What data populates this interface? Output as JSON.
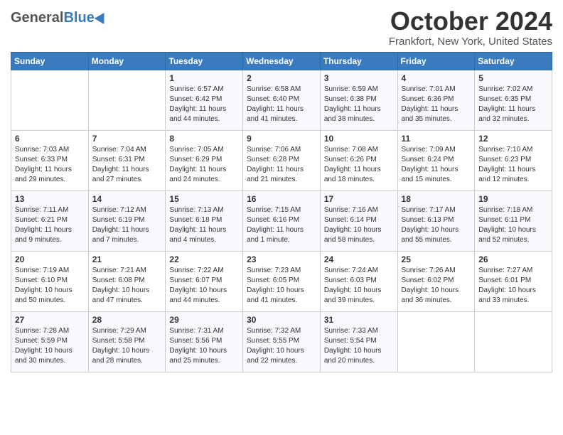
{
  "header": {
    "logo_general": "General",
    "logo_blue": "Blue",
    "month_title": "October 2024",
    "subtitle": "Frankfort, New York, United States"
  },
  "days_of_week": [
    "Sunday",
    "Monday",
    "Tuesday",
    "Wednesday",
    "Thursday",
    "Friday",
    "Saturday"
  ],
  "weeks": [
    [
      null,
      null,
      {
        "day": 1,
        "sunrise": "Sunrise: 6:57 AM",
        "sunset": "Sunset: 6:42 PM",
        "daylight": "Daylight: 11 hours and 44 minutes."
      },
      {
        "day": 2,
        "sunrise": "Sunrise: 6:58 AM",
        "sunset": "Sunset: 6:40 PM",
        "daylight": "Daylight: 11 hours and 41 minutes."
      },
      {
        "day": 3,
        "sunrise": "Sunrise: 6:59 AM",
        "sunset": "Sunset: 6:38 PM",
        "daylight": "Daylight: 11 hours and 38 minutes."
      },
      {
        "day": 4,
        "sunrise": "Sunrise: 7:01 AM",
        "sunset": "Sunset: 6:36 PM",
        "daylight": "Daylight: 11 hours and 35 minutes."
      },
      {
        "day": 5,
        "sunrise": "Sunrise: 7:02 AM",
        "sunset": "Sunset: 6:35 PM",
        "daylight": "Daylight: 11 hours and 32 minutes."
      }
    ],
    [
      {
        "day": 6,
        "sunrise": "Sunrise: 7:03 AM",
        "sunset": "Sunset: 6:33 PM",
        "daylight": "Daylight: 11 hours and 29 minutes."
      },
      {
        "day": 7,
        "sunrise": "Sunrise: 7:04 AM",
        "sunset": "Sunset: 6:31 PM",
        "daylight": "Daylight: 11 hours and 27 minutes."
      },
      {
        "day": 8,
        "sunrise": "Sunrise: 7:05 AM",
        "sunset": "Sunset: 6:29 PM",
        "daylight": "Daylight: 11 hours and 24 minutes."
      },
      {
        "day": 9,
        "sunrise": "Sunrise: 7:06 AM",
        "sunset": "Sunset: 6:28 PM",
        "daylight": "Daylight: 11 hours and 21 minutes."
      },
      {
        "day": 10,
        "sunrise": "Sunrise: 7:08 AM",
        "sunset": "Sunset: 6:26 PM",
        "daylight": "Daylight: 11 hours and 18 minutes."
      },
      {
        "day": 11,
        "sunrise": "Sunrise: 7:09 AM",
        "sunset": "Sunset: 6:24 PM",
        "daylight": "Daylight: 11 hours and 15 minutes."
      },
      {
        "day": 12,
        "sunrise": "Sunrise: 7:10 AM",
        "sunset": "Sunset: 6:23 PM",
        "daylight": "Daylight: 11 hours and 12 minutes."
      }
    ],
    [
      {
        "day": 13,
        "sunrise": "Sunrise: 7:11 AM",
        "sunset": "Sunset: 6:21 PM",
        "daylight": "Daylight: 11 hours and 9 minutes."
      },
      {
        "day": 14,
        "sunrise": "Sunrise: 7:12 AM",
        "sunset": "Sunset: 6:19 PM",
        "daylight": "Daylight: 11 hours and 7 minutes."
      },
      {
        "day": 15,
        "sunrise": "Sunrise: 7:13 AM",
        "sunset": "Sunset: 6:18 PM",
        "daylight": "Daylight: 11 hours and 4 minutes."
      },
      {
        "day": 16,
        "sunrise": "Sunrise: 7:15 AM",
        "sunset": "Sunset: 6:16 PM",
        "daylight": "Daylight: 11 hours and 1 minute."
      },
      {
        "day": 17,
        "sunrise": "Sunrise: 7:16 AM",
        "sunset": "Sunset: 6:14 PM",
        "daylight": "Daylight: 10 hours and 58 minutes."
      },
      {
        "day": 18,
        "sunrise": "Sunrise: 7:17 AM",
        "sunset": "Sunset: 6:13 PM",
        "daylight": "Daylight: 10 hours and 55 minutes."
      },
      {
        "day": 19,
        "sunrise": "Sunrise: 7:18 AM",
        "sunset": "Sunset: 6:11 PM",
        "daylight": "Daylight: 10 hours and 52 minutes."
      }
    ],
    [
      {
        "day": 20,
        "sunrise": "Sunrise: 7:19 AM",
        "sunset": "Sunset: 6:10 PM",
        "daylight": "Daylight: 10 hours and 50 minutes."
      },
      {
        "day": 21,
        "sunrise": "Sunrise: 7:21 AM",
        "sunset": "Sunset: 6:08 PM",
        "daylight": "Daylight: 10 hours and 47 minutes."
      },
      {
        "day": 22,
        "sunrise": "Sunrise: 7:22 AM",
        "sunset": "Sunset: 6:07 PM",
        "daylight": "Daylight: 10 hours and 44 minutes."
      },
      {
        "day": 23,
        "sunrise": "Sunrise: 7:23 AM",
        "sunset": "Sunset: 6:05 PM",
        "daylight": "Daylight: 10 hours and 41 minutes."
      },
      {
        "day": 24,
        "sunrise": "Sunrise: 7:24 AM",
        "sunset": "Sunset: 6:03 PM",
        "daylight": "Daylight: 10 hours and 39 minutes."
      },
      {
        "day": 25,
        "sunrise": "Sunrise: 7:26 AM",
        "sunset": "Sunset: 6:02 PM",
        "daylight": "Daylight: 10 hours and 36 minutes."
      },
      {
        "day": 26,
        "sunrise": "Sunrise: 7:27 AM",
        "sunset": "Sunset: 6:01 PM",
        "daylight": "Daylight: 10 hours and 33 minutes."
      }
    ],
    [
      {
        "day": 27,
        "sunrise": "Sunrise: 7:28 AM",
        "sunset": "Sunset: 5:59 PM",
        "daylight": "Daylight: 10 hours and 30 minutes."
      },
      {
        "day": 28,
        "sunrise": "Sunrise: 7:29 AM",
        "sunset": "Sunset: 5:58 PM",
        "daylight": "Daylight: 10 hours and 28 minutes."
      },
      {
        "day": 29,
        "sunrise": "Sunrise: 7:31 AM",
        "sunset": "Sunset: 5:56 PM",
        "daylight": "Daylight: 10 hours and 25 minutes."
      },
      {
        "day": 30,
        "sunrise": "Sunrise: 7:32 AM",
        "sunset": "Sunset: 5:55 PM",
        "daylight": "Daylight: 10 hours and 22 minutes."
      },
      {
        "day": 31,
        "sunrise": "Sunrise: 7:33 AM",
        "sunset": "Sunset: 5:54 PM",
        "daylight": "Daylight: 10 hours and 20 minutes."
      },
      null,
      null
    ]
  ]
}
